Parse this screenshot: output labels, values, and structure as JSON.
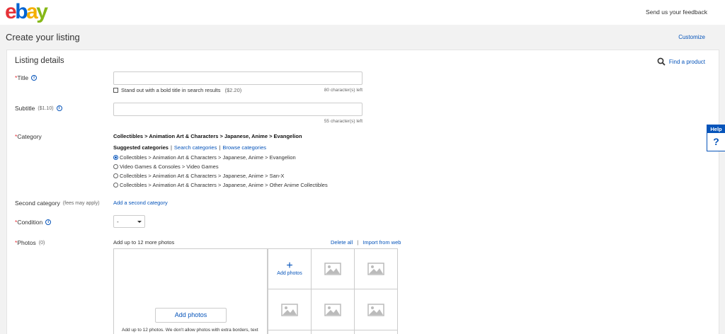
{
  "header": {
    "logo_letters": [
      "e",
      "b",
      "a",
      "y"
    ],
    "feedback_link": "Send us your feedback"
  },
  "page": {
    "title": "Create your listing",
    "customize": "Customize"
  },
  "listing": {
    "section_title": "Listing details",
    "find_product": "Find a product",
    "title_field": {
      "label": "Title",
      "value": "",
      "counter": "80 character(s) left",
      "bold_option": "Stand out with a bold title in search results",
      "bold_price": "($2.20)"
    },
    "subtitle_field": {
      "label": "Subtitle",
      "fee": "($1.10)",
      "value": "",
      "counter": "55 character(s) left"
    },
    "category": {
      "label": "Category",
      "selected_path": "Collectibles > Animation Art & Characters > Japanese, Anime > Evangelion",
      "suggested_label": "Suggested categories",
      "search_link": "Search categories",
      "browse_link": "Browse categories",
      "options": [
        {
          "label": "Collectibles > Animation Art & Characters > Japanese, Anime > Evangelion",
          "selected": true
        },
        {
          "label": "Video Games & Consoles > Video Games",
          "selected": false
        },
        {
          "label": "Collectibles > Animation Art & Characters > Japanese, Anime > San-X",
          "selected": false
        },
        {
          "label": "Collectibles > Animation Art & Characters > Japanese, Anime > Other Anime Collectibles",
          "selected": false
        }
      ]
    },
    "second_category": {
      "label": "Second category",
      "note": "(fees may apply)",
      "link": "Add a second category"
    },
    "condition": {
      "label": "Condition",
      "selected": "-"
    },
    "photos": {
      "label": "Photos",
      "count": "(0)",
      "hint": "Add up to 12 more photos",
      "delete_all": "Delete all",
      "separator": "|",
      "import_web": "Import from web",
      "add_photos_tile": "Add photos",
      "add_photos_button": "Add photos",
      "note": "Add up to 12 photos. We don't allow photos with extra borders, text"
    }
  },
  "help": {
    "label": "Help",
    "icon_text": "?"
  },
  "colors": {
    "ebay_red": "#e53238",
    "ebay_blue": "#0064d2",
    "ebay_yellow": "#f5af02",
    "ebay_green": "#86b817",
    "link_blue": "#0654ba"
  }
}
